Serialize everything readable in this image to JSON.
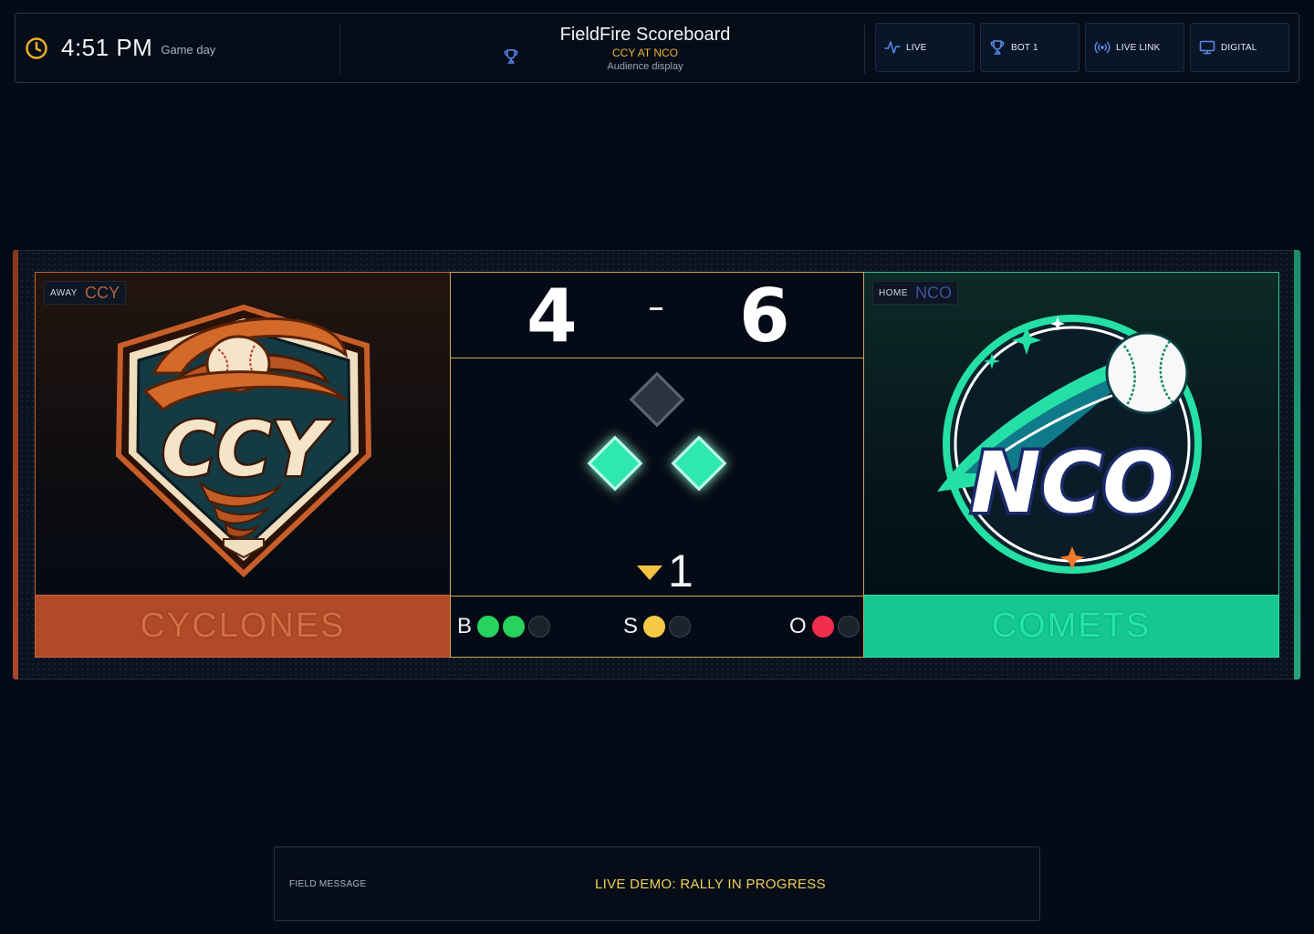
{
  "header": {
    "time": "4:51 PM",
    "time_sub": "Game day",
    "title": "FieldFire Scoreboard",
    "matchup": "CCY AT NCO",
    "subtitle": "Audience display",
    "nav": [
      {
        "label": "LIVE",
        "icon": "activity-icon"
      },
      {
        "label": "BOT 1",
        "icon": "trophy-icon"
      },
      {
        "label": "LIVE LINK",
        "icon": "broadcast-icon"
      },
      {
        "label": "DIGITAL",
        "icon": "monitor-icon"
      }
    ]
  },
  "away": {
    "side": "AWAY",
    "abbr": "CCY",
    "name": "CYCLONES",
    "score": "4",
    "logo_text": "CCY",
    "color": "#b14a26"
  },
  "home": {
    "side": "HOME",
    "abbr": "NCO",
    "name": "COMETS",
    "score": "6",
    "logo_text": "NCO",
    "color": "#16c790"
  },
  "game": {
    "score_separator": "-",
    "inning": "1",
    "half": "bottom",
    "bases": {
      "first": true,
      "second": false,
      "third": true
    },
    "count": {
      "balls_label": "B",
      "balls": 2,
      "balls_max": 3,
      "strikes_label": "S",
      "strikes": 1,
      "strikes_max": 2,
      "outs_label": "O",
      "outs": 1,
      "outs_max": 2
    }
  },
  "field_message": {
    "label": "FIELD MESSAGE",
    "text": "LIVE DEMO: RALLY IN PROGRESS"
  },
  "colors": {
    "accent_gold": "#f0b429",
    "ball": "#27d35c",
    "strike": "#f6c945",
    "out": "#ee2e4a",
    "base_on": "#2ee8b0"
  }
}
